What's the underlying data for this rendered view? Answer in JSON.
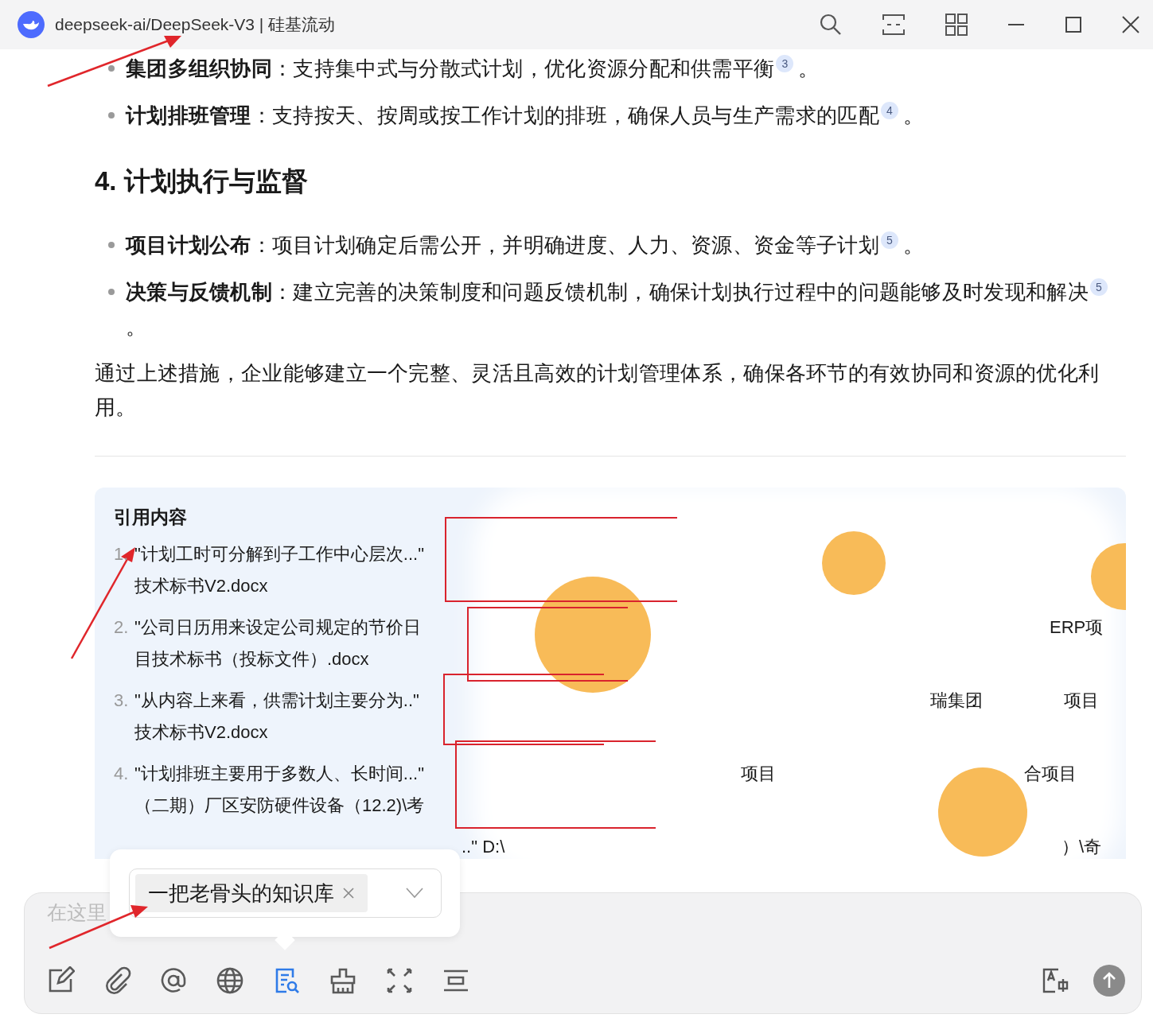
{
  "window": {
    "title": "deepseek-ai/DeepSeek-V3 | 硅基流动"
  },
  "bullets_top": [
    {
      "text": "**集团多组织协同**：支持集中式与分散式计划，优化资源分配和供需平衡$^{3}$。"
    },
    {
      "text": "**计划排班管理**：支持按天、按周或按工作计划的排班，确保人员与生产需求的匹配$^{4}$。"
    }
  ],
  "heading": "4. 计划执行与监督",
  "bullets_bottom": [
    {
      "text": "**项目计划公布**：项目计划确定后需公开，并明确进度、人力、资源、资金等子计划$^{5}$。"
    },
    {
      "text": "**决策与反馈机制**：建立完善的决策制度和问题反馈机制，确保计划执行过程中的问题能够及时发现和解决$^{5}$。"
    }
  ],
  "summary": "通过上述措施，企业能够建立一个完整、灵活且高效的计划管理体系，确保各环节的有效协同和资源的优化利用。",
  "references": {
    "title": "引用内容",
    "items": [
      {
        "number": "1.",
        "quote": "\"计划工时可分解到子工作中心层次...\"",
        "source": "技术标书V2.docx"
      },
      {
        "number": "2.",
        "quote": "\"公司日历用来设定公司规定的节价日",
        "source": "目技术标书（投标文件）.docx",
        "fragments": [
          "ERP项"
        ]
      },
      {
        "number": "3.",
        "quote": "\"从内容上来看，供需计划主要分为..\"",
        "source": "技术标书V2.docx",
        "fragments": [
          "瑞集团",
          "项目"
        ]
      },
      {
        "number": "4.",
        "quote": "\"计划排班主要用于多数人、长时间...\"",
        "source": "（二期）厂区安防硬件设备（12.2)\\考",
        "fragments": [
          "项目",
          "合项目"
        ]
      },
      {
        "fragments": [
          "..\" D:\\",
          "）\\奇"
        ]
      }
    ]
  },
  "knowledge_popup": {
    "tag": "一把老骨头的知识库"
  },
  "composer": {
    "placeholder": "在这里"
  },
  "toolbar": [
    {
      "selected": false
    },
    {
      "selected": false
    },
    {
      "selected": false
    },
    {
      "selected": false
    },
    {
      "selected": true
    },
    {
      "selected": false
    },
    {
      "selected": false
    },
    {
      "selected": false
    }
  ]
}
